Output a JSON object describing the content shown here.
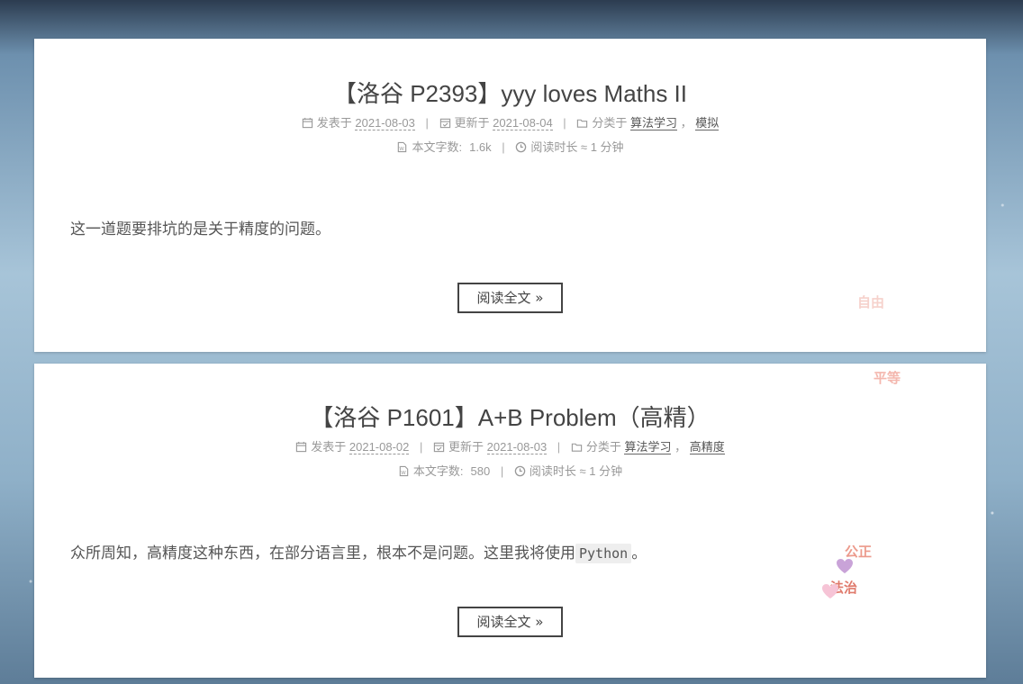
{
  "posts": [
    {
      "title": "【洛谷 P2393】yyy loves Maths II",
      "published_label": "发表于",
      "published_date": "2021-08-03",
      "updated_label": "更新于",
      "updated_date": "2021-08-04",
      "category_label": "分类于",
      "categories": [
        "算法学习",
        "模拟"
      ],
      "wordcount_label": "本文字数:",
      "wordcount": "1.6k",
      "readtime_label": "阅读时长 ≈",
      "readtime": "1 分钟",
      "excerpt": "这一道题要排坑的是关于精度的问题。",
      "read_more": "阅读全文 »"
    },
    {
      "title": "【洛谷 P1601】A+B Problem（高精）",
      "published_label": "发表于",
      "published_date": "2021-08-02",
      "updated_label": "更新于",
      "updated_date": "2021-08-03",
      "category_label": "分类于",
      "categories": [
        "算法学习",
        "高精度"
      ],
      "wordcount_label": "本文字数:",
      "wordcount": "580",
      "readtime_label": "阅读时长 ≈",
      "readtime": "1 分钟",
      "excerpt_before": "众所周知，高精度这种东西，在部分语言里，根本不是问题。这里我将使用",
      "excerpt_code": "Python",
      "excerpt_after": "。",
      "read_more": "阅读全文 »"
    }
  ],
  "floating_words": {
    "w1": "自由",
    "w2": "平等",
    "w3": "公正",
    "w4": "法治"
  },
  "colors": {
    "accent_text": "#444444",
    "meta_text": "#999999",
    "float_word_1": "#f4c7c0",
    "float_word_2": "#f2a9a0",
    "float_word_3": "#e8887a",
    "heart_purple": "#c9a3d8",
    "heart_pink": "#f6b8cf"
  }
}
